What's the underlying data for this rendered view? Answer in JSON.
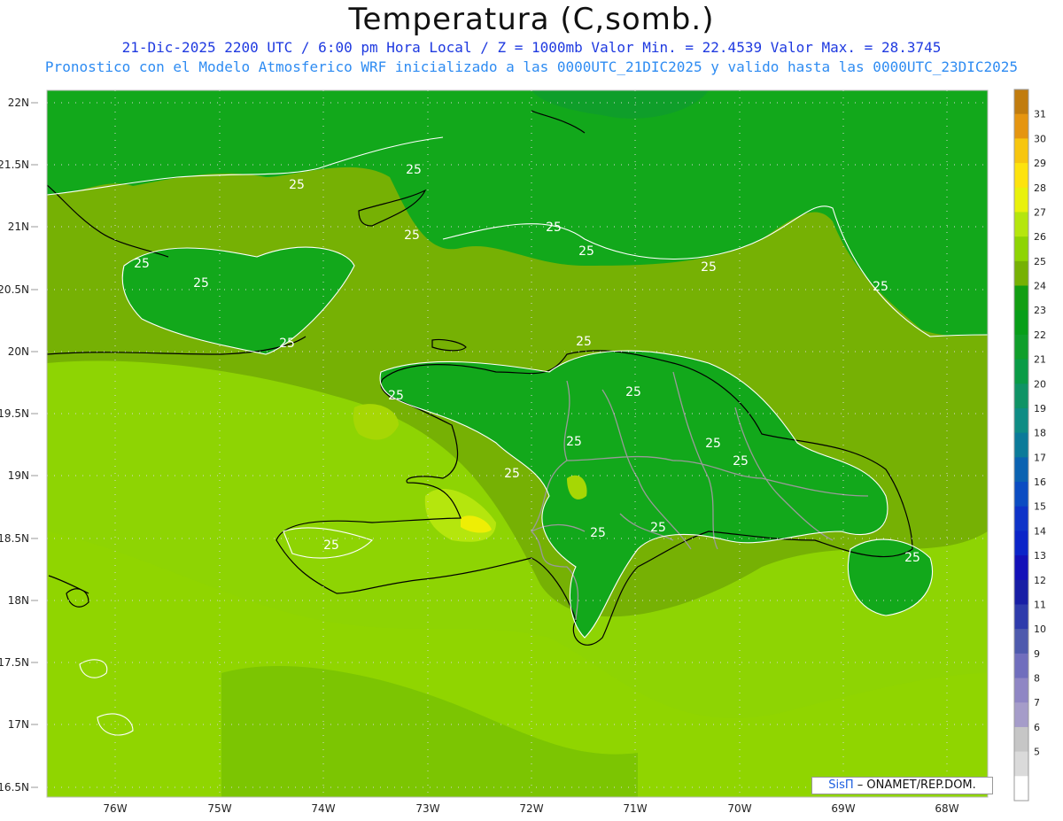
{
  "header": {
    "title": "Temperatura (C,somb.)",
    "line1": "21-Dic-2025  2200 UTC / 6:00 pm Hora Local / Z = 1000mb   Valor Min. = 22.4539  Valor Max. = 28.3745",
    "line2": "Pronostico con el Modelo Atmosferico WRF inicializado a las 0000UTC_21DIC2025 y valido hasta las  0000UTC_23DIC2025"
  },
  "map": {
    "lat_ticks": [
      "22N",
      "21.5N",
      "21N",
      "20.5N",
      "20N",
      "19.5N",
      "19N",
      "18.5N",
      "18N",
      "17.5N",
      "17N",
      "16.5N"
    ],
    "lon_ticks": [
      "76W",
      "75W",
      "74W",
      "73W",
      "72W",
      "71W",
      "70W",
      "69W",
      "68W"
    ],
    "contour_labels": [
      "25",
      "25",
      "25",
      "25",
      "25",
      "25",
      "25",
      "25",
      "25",
      "25",
      "25",
      "25",
      "25",
      "25",
      "25",
      "25",
      "25",
      "25",
      "25",
      "25",
      "25"
    ],
    "colors": {
      "c22": "#0a9a2a",
      "c24": "#12a81b",
      "c25": "#5fa802",
      "c26": "#7ac304",
      "c27": "#a6d704",
      "c28": "#eeee05",
      "c29": "#fec70f"
    }
  },
  "colorbar": {
    "labels": [
      "31",
      "30",
      "29",
      "28",
      "27",
      "26",
      "25",
      "24",
      "23",
      "22",
      "21",
      "20",
      "19",
      "18",
      "17",
      "16",
      "15",
      "14",
      "13",
      "12",
      "11",
      "10",
      "9",
      "8",
      "7",
      "6",
      "5"
    ],
    "colors": [
      "#c17c0e",
      "#e59510",
      "#f7c60f",
      "#fde30e",
      "#e9f10c",
      "#b5e60d",
      "#8ed403",
      "#76b104",
      "#129e12",
      "#079e18",
      "#0f9e2a",
      "#099b46",
      "#0f9365",
      "#0e8c84",
      "#0b7a99",
      "#0a62b1",
      "#0b4cc2",
      "#0e33c8",
      "#0b24c8",
      "#1310b8",
      "#181ea5",
      "#2e3bab",
      "#4e5aad",
      "#706ebd",
      "#8f86c4",
      "#a59cc9",
      "#c6c6c6",
      "#dadada",
      "#ffffff"
    ]
  },
  "credit": {
    "brand": "SisΠ",
    "text": " – ONAMET/REP.DOM."
  }
}
